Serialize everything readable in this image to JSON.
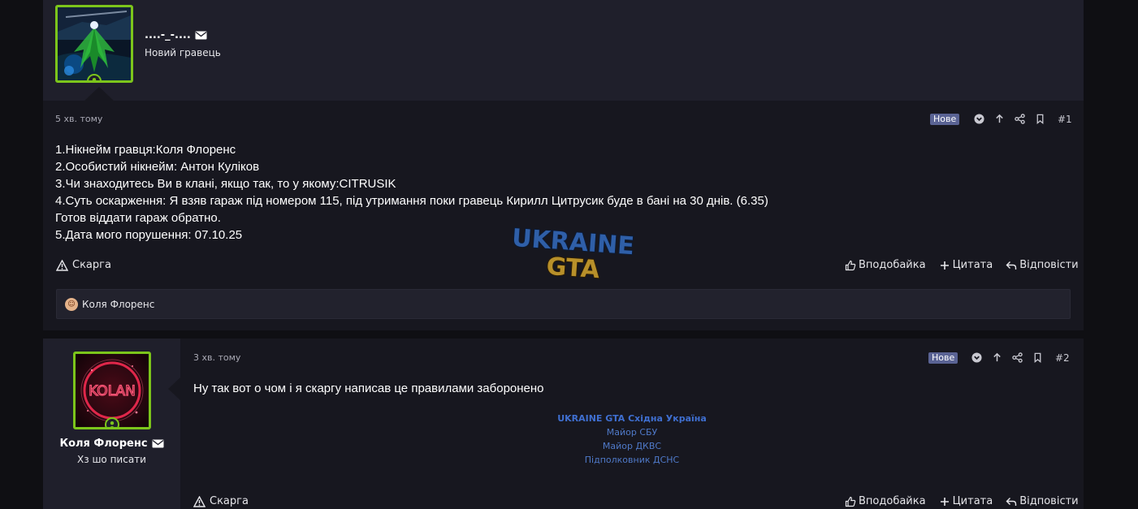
{
  "posts": [
    {
      "username": "....-_-....",
      "user_title": "Новий гравець",
      "time": "5 хв. тому",
      "badge": "Нове",
      "post_number": "#1",
      "message_lines": [
        "1.Нікнейм гравця:Коля Флоренс",
        "2.Особистий нікнейм: Антон Куліков",
        "3.Чи знаходитесь Ви в клані, якщо так, то у якому:CITRUSIK",
        "4.Суть оскарження: Я взяв гараж під номером 115, під утримання поки гравець Кирилл Цитрусик буде в бані на 30 днів. (6.35)",
        "Готов віддати гараж обратно.",
        "5.Дата мого порушення: 07.10.25"
      ],
      "report_label": "Скарга",
      "like_label": "Вподобайка",
      "quote_label": "Цитата",
      "reply_label": "Відповісти",
      "reactions_user": "Коля Флоренс"
    },
    {
      "username": "Коля Флоренс",
      "user_title": "Хз шо писати",
      "time": "3 хв. тому",
      "badge": "Нове",
      "post_number": "#2",
      "message": "Ну так вот о чом і я скаргу написав це правилами заборонено",
      "signature": {
        "title": "UKRAINE GTA Східна Україна",
        "lines": [
          "Майор СБУ",
          "Майор ДКВС",
          "Підполковник ДСНС"
        ]
      },
      "avatar_text": "KOLAN",
      "report_label": "Скарга",
      "like_label": "Вподобайка",
      "quote_label": "Цитата",
      "reply_label": "Відповісти"
    }
  ],
  "logo": {
    "line1": "UKRAINE",
    "line2": "GTA"
  },
  "colors": {
    "online_green": "#7cc51b",
    "badge_bg": "#5a6394",
    "signature_blue": "#3f6fd0"
  }
}
